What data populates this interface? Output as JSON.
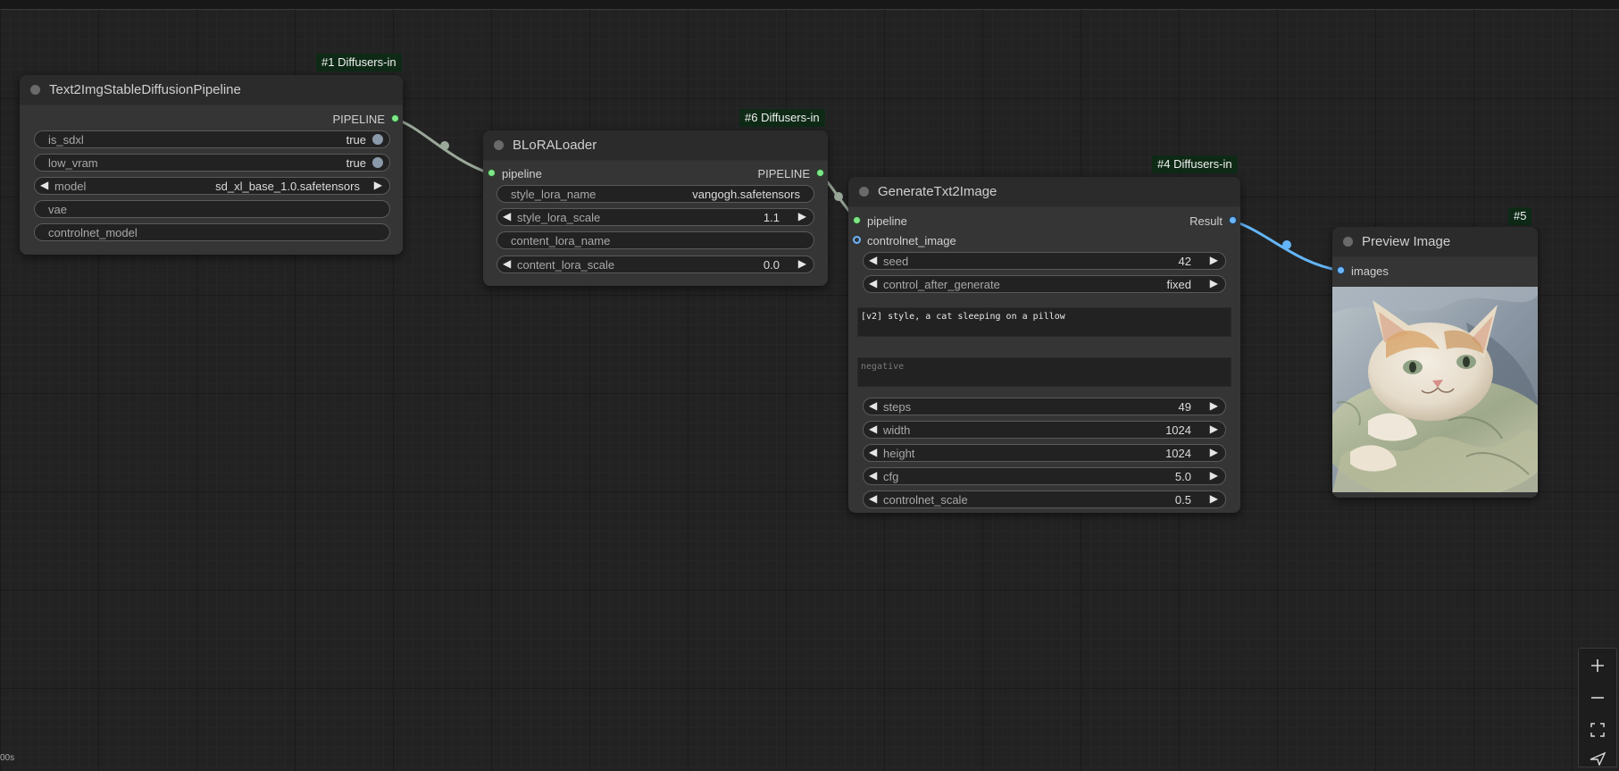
{
  "fps_label": "00s",
  "nodes": {
    "n1": {
      "badge": "#1 Diffusers-in",
      "title": "Text2ImgStableDiffusionPipeline",
      "output": "PIPELINE",
      "widgets": [
        {
          "label": "is_sdxl",
          "value": "true"
        },
        {
          "label": "low_vram",
          "value": "true"
        },
        {
          "label": "model",
          "value": "sd_xl_base_1.0.safetensors"
        },
        {
          "label": "vae",
          "value": ""
        },
        {
          "label": "controlnet_model",
          "value": ""
        }
      ]
    },
    "n6": {
      "badge": "#6 Diffusers-in",
      "title": "BLoRALoader",
      "input": "pipeline",
      "output": "PIPELINE",
      "widgets": [
        {
          "label": "style_lora_name",
          "value": "vangogh.safetensors"
        },
        {
          "label": "style_lora_scale",
          "value": "1.1"
        },
        {
          "label": "content_lora_name",
          "value": ""
        },
        {
          "label": "content_lora_scale",
          "value": "0.0"
        }
      ]
    },
    "n4": {
      "badge": "#4 Diffusers-in",
      "title": "GenerateTxt2Image",
      "inputs": [
        "pipeline",
        "controlnet_image"
      ],
      "output": "Result",
      "widgets_top": [
        {
          "label": "seed",
          "value": "42"
        },
        {
          "label": "control_after_generate",
          "value": "fixed"
        }
      ],
      "positive_prompt": "[v2] style, a cat sleeping on a pillow",
      "negative_placeholder": "negative",
      "widgets_bottom": [
        {
          "label": "steps",
          "value": "49"
        },
        {
          "label": "width",
          "value": "1024"
        },
        {
          "label": "height",
          "value": "1024"
        },
        {
          "label": "cfg",
          "value": "5.0"
        },
        {
          "label": "controlnet_scale",
          "value": "0.5"
        }
      ]
    },
    "n5": {
      "badge": "#5",
      "title": "Preview Image",
      "input": "images"
    }
  },
  "colors": {
    "pipeline_link": "#9aa89a",
    "image_link": "#64b5f6",
    "badge_bg": "#0e2a16"
  },
  "zoom_controls": [
    "zoom-in",
    "zoom-out",
    "fit-view",
    "toggle-links"
  ]
}
